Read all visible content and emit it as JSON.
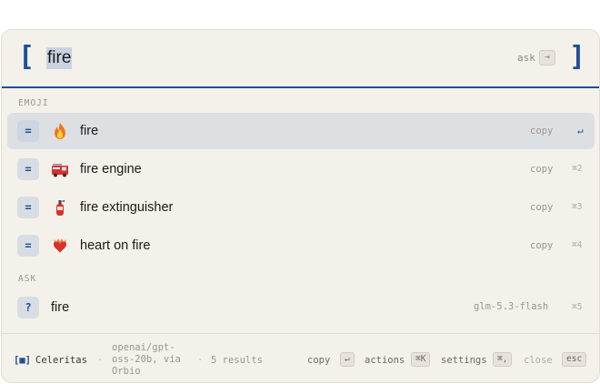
{
  "search": {
    "open_bracket": "[",
    "close_bracket": "]",
    "query": "fire",
    "ask_hint": "ask",
    "ask_key": "⇥"
  },
  "sections": {
    "emoji": "EMOJI",
    "ask": "ASK"
  },
  "emoji_results": [
    {
      "badge": "=",
      "emoji": "fire-emoji",
      "label": "fire",
      "action": "copy",
      "shortcut": "↵"
    },
    {
      "badge": "=",
      "emoji": "fire-engine-emoji",
      "label": "fire engine",
      "action": "copy",
      "shortcut": "⌘2"
    },
    {
      "badge": "=",
      "emoji": "fire-extinguisher-emoji",
      "label": "fire extinguisher",
      "action": "copy",
      "shortcut": "⌘3"
    },
    {
      "badge": "=",
      "emoji": "heart-on-fire-emoji",
      "label": "heart on fire",
      "action": "copy",
      "shortcut": "⌘4"
    }
  ],
  "ask_result": {
    "badge": "?",
    "label": "fire",
    "model": "glm-5.3-flash",
    "shortcut": "⌘5"
  },
  "footer": {
    "brand_icon": "[■]",
    "brand": "Celeritas",
    "sep": "·",
    "model_info": "openai/gpt-oss-20b, via Orbio",
    "results": "5 results",
    "copy_label": "copy",
    "copy_key": "↵",
    "actions_label": "actions",
    "actions_key": "⌘K",
    "settings_label": "settings",
    "settings_key": "⌘,",
    "close_label": "close",
    "close_key": "esc"
  },
  "colors": {
    "accent": "#1f4f96",
    "background": "#f4f1ea",
    "selected_row": "#dde0e2",
    "query_highlight": "#c9d3e0"
  }
}
